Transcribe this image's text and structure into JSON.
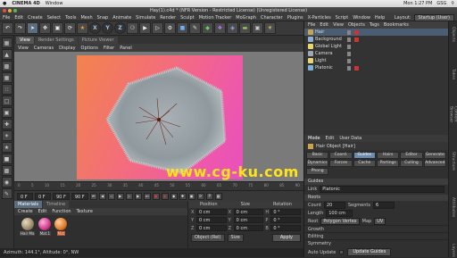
{
  "mac_bar": {
    "app": "CINEMA 4D",
    "menu": "Window",
    "right": [
      "Mon 1:27 PM",
      "GSG"
    ]
  },
  "window": {
    "title": "Hay(1).c4d * (NFR Version - Restricted License) (Unregistered License)"
  },
  "menubar": {
    "items": [
      "File",
      "Edit",
      "Create",
      "Select",
      "Tools",
      "Mesh",
      "Snap",
      "Animate",
      "Simulate",
      "Render",
      "Sculpt",
      "Motion Tracker",
      "MoGraph",
      "Character",
      "Plugins",
      "X-Particles",
      "Script",
      "Window",
      "Help"
    ],
    "layout_label": "Layout:",
    "layout_value": "Startup (User)"
  },
  "toolbar": {
    "axis_labels": [
      "X",
      "Y",
      "Z"
    ]
  },
  "viewport": {
    "tabs": [
      "View",
      "Render Settings",
      "Picture Viewer"
    ],
    "menu": [
      "View",
      "Cameras",
      "Display",
      "Options",
      "Filter",
      "Panel"
    ],
    "watermark": "www.cg-ku.com"
  },
  "timeline": {
    "ticks": [
      "0",
      "5",
      "10",
      "15",
      "20",
      "25",
      "30",
      "35",
      "40",
      "45",
      "50",
      "55",
      "60",
      "65",
      "70",
      "75",
      "80",
      "85",
      "90"
    ]
  },
  "transport": {
    "start": "0 F",
    "current": "0 F",
    "end": "90 F",
    "end2": "90 F"
  },
  "materials": {
    "tabs": [
      "Materials",
      "Timeline"
    ],
    "menu": [
      "Create",
      "Edit",
      "Function",
      "Texture"
    ],
    "items": [
      {
        "label": "Hair Ma",
        "color": "#9a8a6a"
      },
      {
        "label": "Mat.1",
        "color": "#d03a8a"
      },
      {
        "label": "Mat",
        "color": "#e07a2a"
      }
    ]
  },
  "coords": {
    "headers": [
      "Position",
      "Size",
      "Rotation"
    ],
    "rows": [
      {
        "axis": "X",
        "pos": "0 cm",
        "size_axis": "X",
        "size": "0 cm",
        "rot_axis": "H",
        "rot": "0 °"
      },
      {
        "axis": "Y",
        "pos": "0 cm",
        "size_axis": "Y",
        "size": "0 cm",
        "rot_axis": "P",
        "rot": "0 °"
      },
      {
        "axis": "Z",
        "pos": "0 cm",
        "size_axis": "Z",
        "size": "0 cm",
        "rot_axis": "B",
        "rot": "0 °"
      }
    ],
    "mode": "Object (Rel)",
    "size_mode": "Size",
    "apply": "Apply"
  },
  "status": {
    "text": "Azimuth: 144.1°, Altitude: 0°, NW"
  },
  "object_manager": {
    "tabs": [
      "Objects",
      "Takes",
      "Content Browser",
      "Structure"
    ],
    "menu": [
      "File",
      "Edit",
      "View",
      "Objects",
      "Tags",
      "Bookmarks"
    ],
    "objects": [
      {
        "name": "Hair",
        "color": "#c9a24a",
        "selected": true
      },
      {
        "name": "Background",
        "color": "#8ab0d8",
        "selected": false
      },
      {
        "name": "Global Light",
        "color": "#e8d86a",
        "selected": false
      },
      {
        "name": "Camera",
        "color": "#9aa8b8",
        "selected": false
      },
      {
        "name": "Light",
        "color": "#e8d86a",
        "selected": false
      },
      {
        "name": "Platonic",
        "color": "#7ab0e0",
        "selected": false
      }
    ]
  },
  "attributes": {
    "tabs": [
      "Mode",
      "Edit",
      "User Data"
    ],
    "title": "Hair Object [Hair]",
    "buttons_row1": [
      "Basic",
      "Coord.",
      "Guides",
      "Hairs",
      "Editor",
      "Generate"
    ],
    "buttons_row2": [
      "Dynamics",
      "Forces",
      "Cache",
      "Partings",
      "Culling",
      "Advanced"
    ],
    "buttons_row3": [
      "Phong"
    ],
    "active_button": "Guides",
    "section": "Guides",
    "link_label": "Link",
    "link_value": "Platonic",
    "roots_label": "Roots",
    "count_label": "Count",
    "count_value": "20",
    "segments_label": "Segments",
    "segments_value": "6",
    "length_label": "Length",
    "length_value": "100 cm",
    "root_label": "Root",
    "root_value": "Polygon Vertex",
    "map_label": "Map",
    "map_value": "UV",
    "folds": [
      "Growth",
      "Editing",
      "Symmetry"
    ],
    "auto_update": "Auto Update",
    "update_button": "Update Guides"
  },
  "right_strip": {
    "labels": [
      "Objects",
      "Takes",
      "Content Browser",
      "Structure",
      "Attributes",
      "Layers"
    ]
  }
}
